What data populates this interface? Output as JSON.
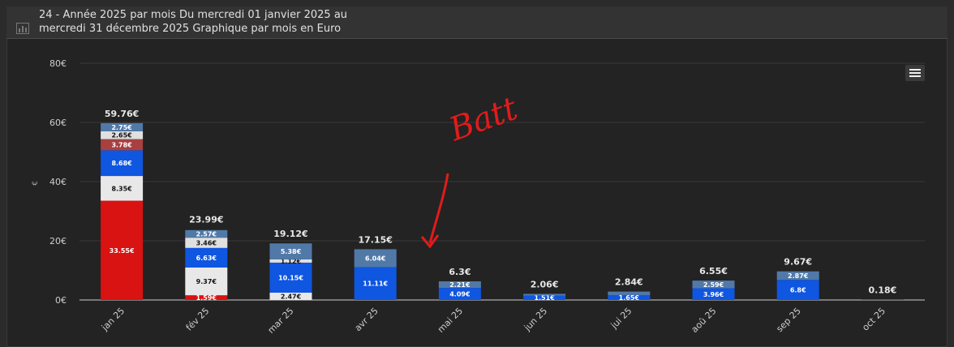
{
  "header": {
    "title": "24 - Année 2025 par mois Du mercredi 01 janvier 2025 au mercredi 31 décembre 2025 Graphique par mois en Euro",
    "icon": "bar-chart-icon"
  },
  "menu": {
    "icon": "hamburger-menu-icon"
  },
  "annotation": {
    "text": "Batt",
    "color": "#e11b1b"
  },
  "colors": {
    "background": "#232323",
    "grid": "#3a3a3a",
    "axis": "#cfcfcf"
  },
  "chart_data": {
    "type": "bar",
    "stacked": true,
    "title": "",
    "xlabel": "",
    "ylabel": "€",
    "ylim": [
      0,
      80
    ],
    "yticks": [
      0,
      20,
      40,
      60,
      80
    ],
    "ytick_labels": [
      "0€",
      "20€",
      "40€",
      "60€",
      "80€"
    ],
    "grid": true,
    "legend": "none",
    "categories": [
      "jan 25",
      "fév 25",
      "mar 25",
      "avr 25",
      "mai 25",
      "jun 25",
      "jui 25",
      "aoû 25",
      "sep 25",
      "oct 25"
    ],
    "totals": [
      "59.76€",
      "23.99€",
      "19.12€",
      "17.15€",
      "6.3€",
      "2.06€",
      "2.84€",
      "6.55€",
      "9.67€",
      "0.18€"
    ],
    "total_values": [
      59.76,
      23.99,
      19.12,
      17.15,
      6.3,
      2.06,
      2.84,
      6.55,
      9.67,
      0.18
    ],
    "series": [
      {
        "color": "#d91212",
        "values": [
          33.55,
          1.59,
          0,
          0,
          0,
          0,
          0,
          0,
          0,
          0
        ],
        "labels": [
          "33.55€",
          "1.59€",
          "",
          "",
          "",
          "",
          "",
          "",
          "",
          ""
        ]
      },
      {
        "color": "#e8e8e8",
        "values": [
          8.35,
          9.37,
          2.47,
          0,
          0,
          0,
          0,
          0,
          0,
          0
        ],
        "labels": [
          "8.35€",
          "9.37€",
          "2.47€",
          "",
          "",
          "",
          "",
          "",
          "",
          ""
        ]
      },
      {
        "color": "#0f56e0",
        "values": [
          8.68,
          6.63,
          10.15,
          11.11,
          4.09,
          1.51,
          1.65,
          3.96,
          6.8,
          0
        ],
        "labels": [
          "8.68€",
          "6.63€",
          "10.15€",
          "11.11€",
          "4.09€",
          "1.51€",
          "1.65€",
          "3.96€",
          "6.8€",
          ""
        ]
      },
      {
        "color": "#a84040",
        "values": [
          3.78,
          0,
          0,
          0,
          0,
          0,
          0,
          0,
          0,
          0
        ],
        "labels": [
          "3.78€",
          "",
          "",
          "",
          "",
          "",
          "",
          "",
          "",
          ""
        ]
      },
      {
        "color": "#e0e0e0",
        "values": [
          2.65,
          3.46,
          1.12,
          0,
          0,
          0,
          0,
          0,
          0,
          0
        ],
        "labels": [
          "2.65€",
          "3.46€",
          "1.12€",
          "",
          "",
          "",
          "",
          "",
          "",
          ""
        ]
      },
      {
        "color": "#5179a8",
        "values": [
          2.75,
          2.57,
          5.38,
          6.04,
          2.21,
          0.55,
          1.19,
          2.59,
          2.87,
          0.18
        ],
        "labels": [
          "2.75€",
          "2.57€",
          "5.38€",
          "6.04€",
          "2.21€",
          "",
          "",
          "2.59€",
          "2.87€",
          ""
        ]
      }
    ]
  }
}
